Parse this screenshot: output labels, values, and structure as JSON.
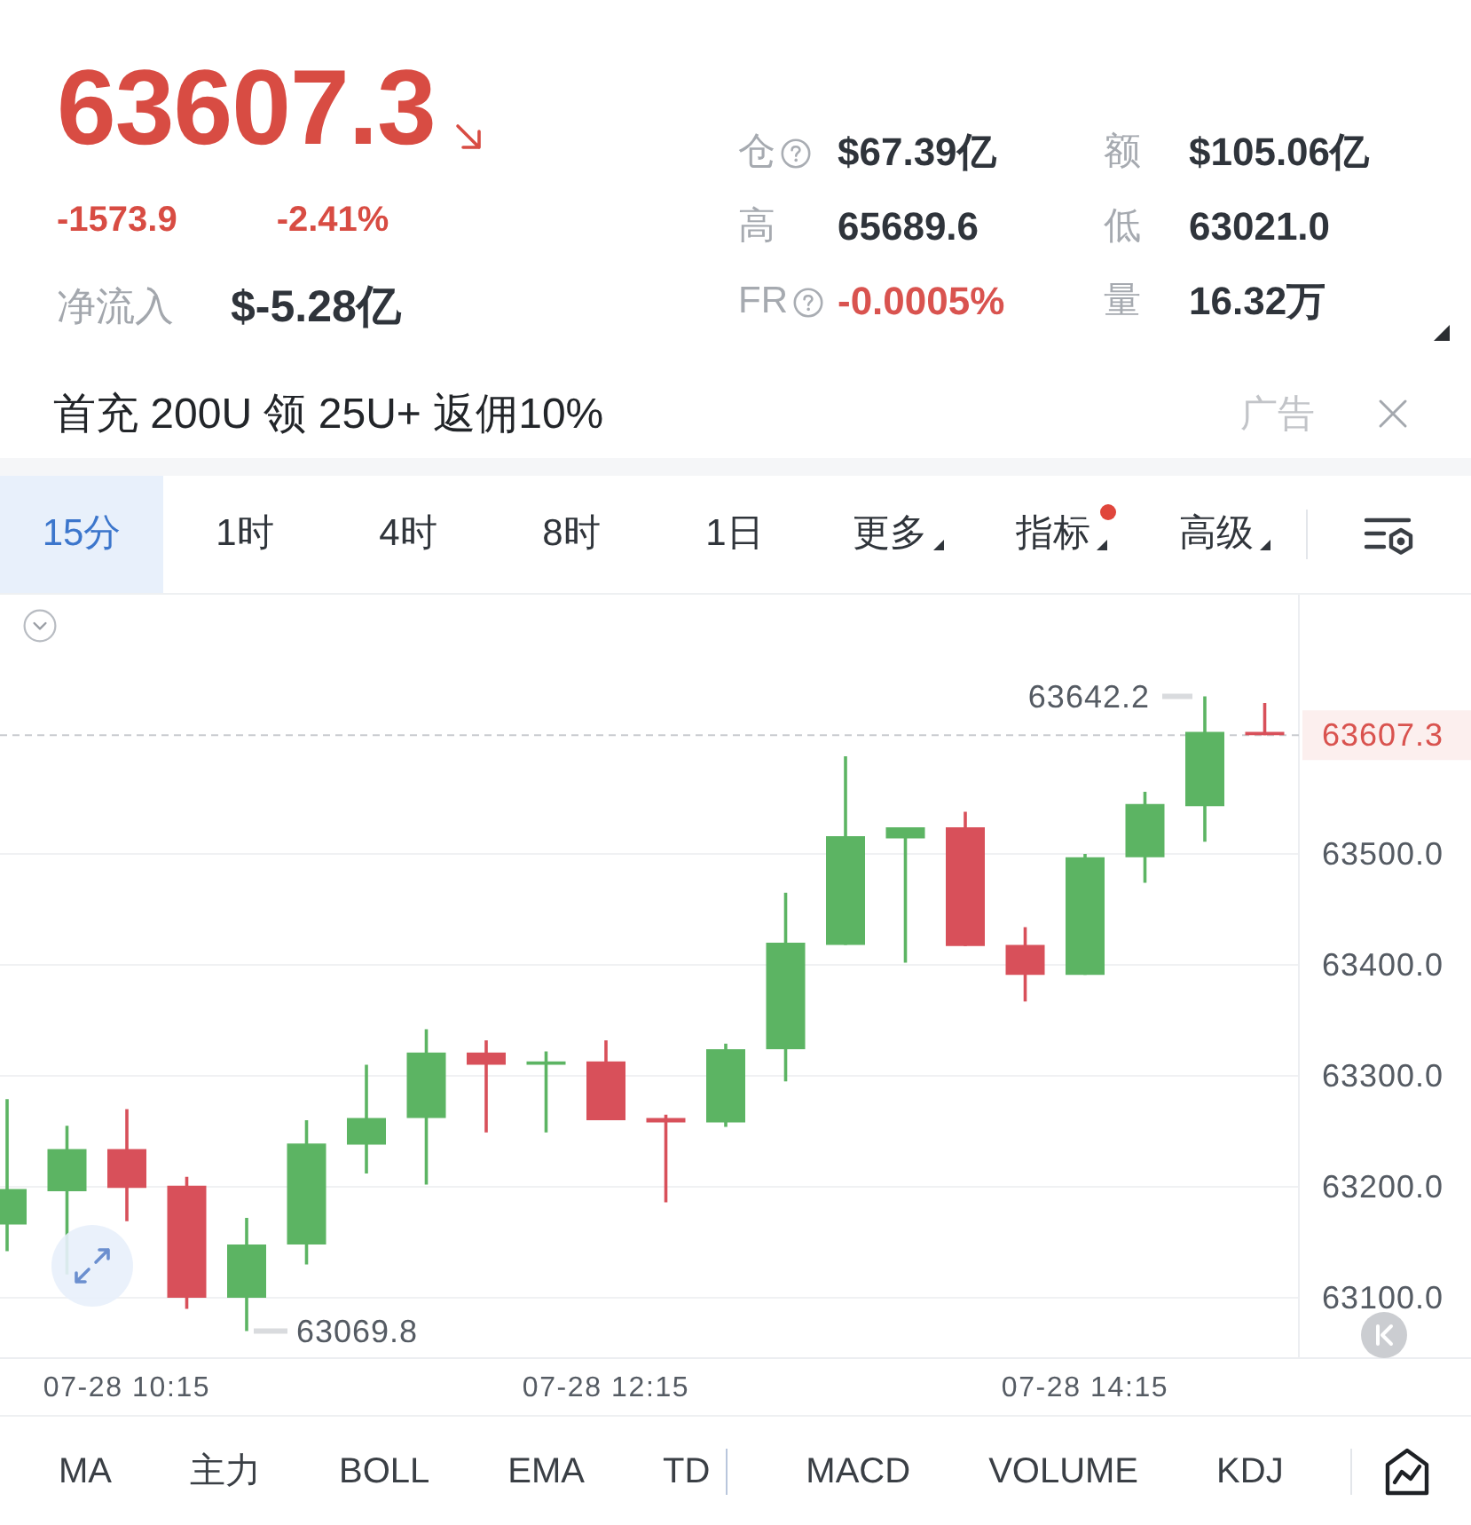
{
  "ticker": {
    "price": "63607.3",
    "falling": true,
    "change": "-1573.9",
    "change_percent": "-2.41%",
    "net_inflow": {
      "label": "净流入",
      "value": "$-5.28亿"
    }
  },
  "stats": [
    {
      "label": "仓",
      "help": true,
      "value": "$67.39亿",
      "negative": false
    },
    {
      "label": "额",
      "help": false,
      "value": "$105.06亿",
      "negative": false
    },
    {
      "label": "高",
      "help": false,
      "value": "65689.6",
      "negative": false
    },
    {
      "label": "低",
      "help": false,
      "value": "63021.0",
      "negative": false
    },
    {
      "label": "FR",
      "help": true,
      "value": "-0.0005%",
      "negative": true
    },
    {
      "label": "量",
      "help": false,
      "value": "16.32万",
      "negative": false
    }
  ],
  "ad": {
    "text": "首充 200U 领 25U+ 返佣10%",
    "tag": "广告"
  },
  "timeframe_tabs": [
    {
      "label": "15分",
      "selected": true,
      "dropdown": false,
      "dot": false
    },
    {
      "label": "1时",
      "selected": false,
      "dropdown": false,
      "dot": false
    },
    {
      "label": "4时",
      "selected": false,
      "dropdown": false,
      "dot": false
    },
    {
      "label": "8时",
      "selected": false,
      "dropdown": false,
      "dot": false
    },
    {
      "label": "1日",
      "selected": false,
      "dropdown": false,
      "dot": false
    },
    {
      "label": "更多",
      "selected": false,
      "dropdown": true,
      "dot": false
    },
    {
      "label": "指标",
      "selected": false,
      "dropdown": true,
      "dot": true
    },
    {
      "label": "高级",
      "selected": false,
      "dropdown": true,
      "dot": false
    }
  ],
  "chart": {
    "high_label": "63642.2",
    "last_price_label": "63607.3",
    "price_labels": [
      "63500.0",
      "63400.0",
      "63300.0",
      "63200.0",
      "63100.0"
    ],
    "low_label": "63069.8",
    "time_labels": [
      "07-28 10:15",
      "07-28 12:15",
      "07-28 14:15"
    ]
  },
  "indicator_bar": {
    "main": [
      "MA",
      "主力",
      "BOLL",
      "EMA",
      "TD"
    ],
    "sub": [
      "MACD",
      "VOLUME",
      "KDJ"
    ]
  }
}
